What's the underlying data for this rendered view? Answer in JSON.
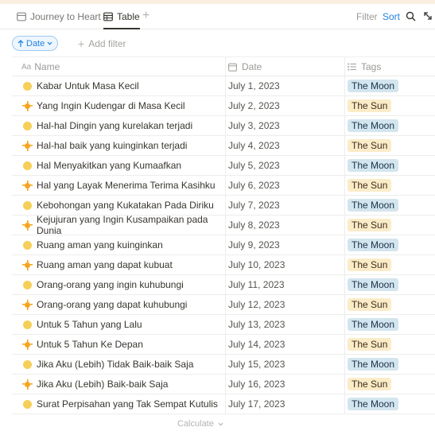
{
  "colors": {
    "accent": "#2383e2",
    "moon_tag_bg": "#d3e5ef",
    "sun_tag_bg": "#fbecc8"
  },
  "views": [
    {
      "label": "Journey to Heart",
      "icon": "table-icon"
    },
    {
      "label": "Table",
      "icon": "table-icon",
      "active": true
    }
  ],
  "toolbar": {
    "filter_label": "Filter",
    "sort_label": "Sort",
    "add_view": "+"
  },
  "filters": {
    "date_chip": "Date",
    "add_filter": "Add filter"
  },
  "columns": {
    "name": "Name",
    "date": "Date",
    "tags": "Tags",
    "name_icon": "Aa"
  },
  "rows": [
    {
      "icon": "moon",
      "name": "Kabar Untuk Masa Kecil",
      "date": "July 1, 2023",
      "tag": "The Moon"
    },
    {
      "icon": "sun",
      "name": "Yang Ingin Kudengar di Masa Kecil",
      "date": "July 2, 2023",
      "tag": "The Sun"
    },
    {
      "icon": "moon",
      "name": "Hal-hal Dingin yang kurelakan terjadi",
      "date": "July 3, 2023",
      "tag": "The Moon"
    },
    {
      "icon": "sun",
      "name": "Hal-hal baik yang kuinginkan terjadi",
      "date": "July 4, 2023",
      "tag": "The Sun"
    },
    {
      "icon": "moon",
      "name": "Hal Menyakitkan yang Kumaafkan",
      "date": "July 5, 2023",
      "tag": "The Moon"
    },
    {
      "icon": "sun",
      "name": "Hal yang Layak Menerima Terima Kasihku",
      "date": "July 6, 2023",
      "tag": "The Sun"
    },
    {
      "icon": "moon",
      "name": "Kebohongan yang Kukatakan Pada Diriku",
      "date": "July 7, 2023",
      "tag": "The Moon"
    },
    {
      "icon": "sun",
      "name": "Kejujuran yang Ingin Kusampaikan pada Dunia",
      "date": "July 8, 2023",
      "tag": "The Sun"
    },
    {
      "icon": "moon",
      "name": "Ruang aman yang kuinginkan",
      "date": "July 9, 2023",
      "tag": "The Moon"
    },
    {
      "icon": "sun",
      "name": "Ruang aman yang dapat kubuat",
      "date": "July 10, 2023",
      "tag": "The Sun"
    },
    {
      "icon": "moon",
      "name": "Orang-orang yang ingin kuhubungi",
      "date": "July 11, 2023",
      "tag": "The Moon"
    },
    {
      "icon": "sun",
      "name": "Orang-orang yang dapat kuhubungi",
      "date": "July 12, 2023",
      "tag": "The Sun"
    },
    {
      "icon": "moon",
      "name": "Untuk 5 Tahun yang Lalu",
      "date": "July 13, 2023",
      "tag": "The Moon"
    },
    {
      "icon": "sun",
      "name": "Untuk 5 Tahun Ke Depan",
      "date": "July 14, 2023",
      "tag": "The Sun"
    },
    {
      "icon": "moon",
      "name": "Jika Aku (Lebih) Tidak Baik-baik Saja",
      "date": "July 15, 2023",
      "tag": "The Moon"
    },
    {
      "icon": "sun",
      "name": "Jika Aku (Lebih) Baik-baik Saja",
      "date": "July 16, 2023",
      "tag": "The Sun"
    },
    {
      "icon": "moon",
      "name": "Surat Perpisahan yang Tak Sempat Kutulis",
      "date": "July 17, 2023",
      "tag": "The Moon"
    }
  ],
  "footer": {
    "calculate_label": "Calculate"
  }
}
